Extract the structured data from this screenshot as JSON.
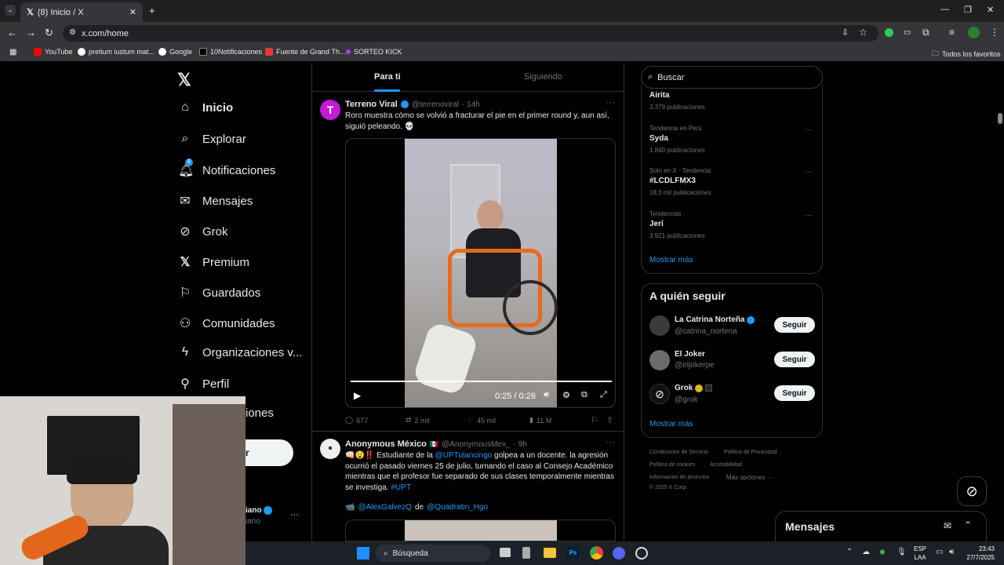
{
  "browser": {
    "tab_title": "(8) Inicio / X",
    "url": "x.com/home",
    "bookmarks": [
      "YouTube",
      "pretium iustum mat...",
      "Google",
      "10Notificaciones",
      "Fuente de Grand Th...",
      "SORTEO KICK"
    ],
    "all_bookmarks": "Todos los favoritos"
  },
  "nav": {
    "items": [
      {
        "label": "Inicio",
        "icon": "home-icon"
      },
      {
        "label": "Explorar",
        "icon": "search-icon"
      },
      {
        "label": "Notificaciones",
        "icon": "bell-icon",
        "badge": "8"
      },
      {
        "label": "Mensajes",
        "icon": "mail-icon"
      },
      {
        "label": "Grok",
        "icon": "grok-icon"
      },
      {
        "label": "Premium",
        "icon": "x-icon"
      },
      {
        "label": "Guardados",
        "icon": "bookmark-icon"
      },
      {
        "label": "Comunidades",
        "icon": "people-icon"
      },
      {
        "label": "Organizaciones v...",
        "icon": "lightning-icon"
      },
      {
        "label": "Perfil",
        "icon": "person-icon"
      },
      {
        "label": "iones",
        "icon": "more-icon"
      }
    ],
    "post_button": "r",
    "account_name": "iano",
    "account_handle": "iano"
  },
  "feed": {
    "tabs": [
      "Para ti",
      "Siguiendo"
    ],
    "posts": [
      {
        "name": "Terreno Viral",
        "handle": "@terrenoviral",
        "time": "· 14h",
        "text": "Roro muestra cómo se volvió a fracturar el pie en el primer round y, aun así, siguió peleando. 💀",
        "video_time": "0:25 / 0:26",
        "replies": "677",
        "reposts": "2 mil",
        "likes": "45 mil",
        "views": "11 M"
      },
      {
        "name": "Anonymous México",
        "handle": "@AnonymousMex_",
        "time": "· 9h",
        "text_a": "👊🏻😧‼️ Estudiante de la ",
        "mention1": "@UPTulancingo",
        "text_b": " golpea a un docente. la agresión ocurrió el pasado viernes 25 de julio, turnando el caso al Consejo Académico mientras que el profesor fue separado de sus clases temporalmente mientras se investiga. ",
        "hashtag": "#UPT",
        "credit_icon": "📹",
        "mention2": "@AlexGalvezQ",
        "credit_de": "de",
        "mention3": "@Quadratin_Hgo"
      }
    ]
  },
  "sidebar": {
    "search_placeholder": "Buscar",
    "trends": [
      {
        "meta": "",
        "name": "Airita",
        "count": "3.379 publicaciones"
      },
      {
        "meta": "Tendencia en Perú",
        "name": "Syda",
        "count": "1.840 publicaciones"
      },
      {
        "meta": "Solo en X · Tendencia",
        "name": "#LCDLFMX3",
        "count": "18,3 mil publicaciones"
      },
      {
        "meta": "Tendencias",
        "name": "Jerí",
        "count": "3.921 publicaciones"
      }
    ],
    "show_more": "Mostrar más",
    "who_to_follow_title": "A quién seguir",
    "follow_label": "Seguir",
    "suggestions": [
      {
        "name": "La Catrina Norteña",
        "handle": "@catrina_nortena"
      },
      {
        "name": "El Joker",
        "handle": "@eljokerpe"
      },
      {
        "name": "Grok",
        "handle": "@grok"
      }
    ],
    "show_more_2": "Mostrar más",
    "footer_links": [
      "Condiciones de Servicio",
      "Política de Privacidad",
      "Política de cookies",
      "Accesibilidad",
      "Información de anuncios",
      "Más opciones ···"
    ],
    "copyright": "© 2025 X Corp.",
    "messages_title": "Mensajes"
  },
  "taskbar": {
    "search": "Búsqueda",
    "lang": "ESP",
    "lang2": "LAA",
    "time": "23:43",
    "date": "27/7/2025"
  },
  "colors": {
    "accent": "#1d9bf0",
    "background": "#000000",
    "border": "#2f3336"
  }
}
